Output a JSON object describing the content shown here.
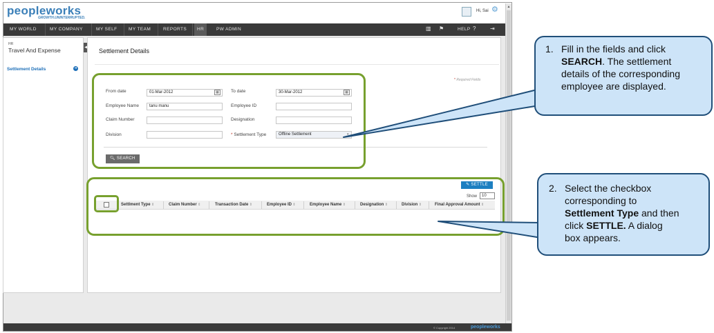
{
  "app": {
    "logo": "peopleworks",
    "tagline": "GROWTH.UNINTERRUPTED.",
    "user_greeting": "Hi, Sai"
  },
  "nav": {
    "items": [
      "MY WORLD",
      "MY COMPANY",
      "MY SELF",
      "MY TEAM",
      "REPORTS",
      "HR",
      "PW ADMIN"
    ],
    "active": "HR",
    "help_label": "HELP"
  },
  "sidebar": {
    "section": "HR",
    "title": "Travel And Expense",
    "items": [
      {
        "label": "Settlement Details",
        "active": true
      }
    ]
  },
  "page": {
    "title": "Settlement Details",
    "required_note": "Required Fields"
  },
  "form": {
    "from_date": {
      "label": "From date",
      "value": "01-Mar-2012"
    },
    "to_date": {
      "label": "To date",
      "value": "30-Mar-2012"
    },
    "employee_name": {
      "label": "Employee Name",
      "value": "tanu manu"
    },
    "employee_id": {
      "label": "Employee ID",
      "value": ""
    },
    "claim_number": {
      "label": "Claim Number",
      "value": ""
    },
    "designation": {
      "label": "Designation",
      "value": ""
    },
    "division": {
      "label": "Division",
      "value": ""
    },
    "settlement_type": {
      "label": "Settlement Type",
      "value": "Offline Settlement",
      "required": true
    },
    "search_label": "SEARCH"
  },
  "grid": {
    "settle_label": "SETTLE",
    "show_label": "Show",
    "show_value": "10",
    "columns": [
      "Settlment Type",
      "Claim Number",
      "Transaction Date",
      "Employee ID",
      "Employee Name",
      "Designation",
      "Division",
      "Final Approval Amount"
    ]
  },
  "footer": {
    "copyright": "© Copyright 2014",
    "logo": "peopleworks"
  },
  "callouts": [
    {
      "number": "1.",
      "lines": [
        [
          {
            "t": "Fill in the fields and click",
            "b": false
          }
        ],
        [
          {
            "t": "SEARCH",
            "b": true
          },
          {
            "t": ". The settlement",
            "b": false
          }
        ],
        [
          {
            "t": "details of the corresponding",
            "b": false
          }
        ],
        [
          {
            "t": "employee are displayed.",
            "b": false
          }
        ]
      ]
    },
    {
      "number": "2.",
      "lines": [
        [
          {
            "t": "Select the checkbox",
            "b": false
          }
        ],
        [
          {
            "t": "corresponding to",
            "b": false
          }
        ],
        [
          {
            "t": "Settlement Type",
            "b": true
          },
          {
            "t": " and then",
            "b": false
          }
        ],
        [
          {
            "t": "click ",
            "b": false
          },
          {
            "t": "SETTLE.",
            "b": true
          },
          {
            "t": " A dialog",
            "b": false
          }
        ],
        [
          {
            "t": "box appears.",
            "b": false
          }
        ]
      ]
    }
  ],
  "colors": {
    "highlight": "#77a02e",
    "callout_fill": "#cde4f8",
    "callout_border": "#1f4e79",
    "accent": "#1d7fc1"
  }
}
